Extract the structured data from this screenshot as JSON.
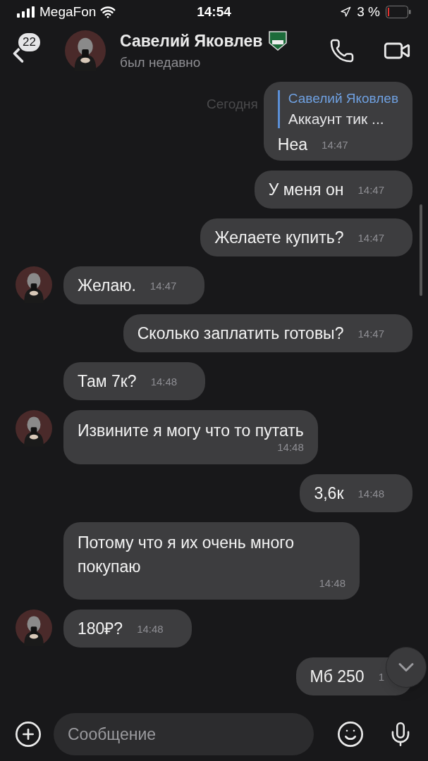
{
  "status_bar": {
    "carrier": "MegaFon",
    "time": "14:54",
    "battery": "3 %"
  },
  "header": {
    "back_badge": "22",
    "name": "Савелий Яковлев",
    "status": "был недавно"
  },
  "date_label": "Сегодня",
  "messages": [
    {
      "kind": "out",
      "reply": {
        "author": "Савелий Яковлев",
        "text": "Аккаунт тик ..."
      },
      "text": "Неа",
      "time": "14:47"
    },
    {
      "kind": "out",
      "text": "У меня он",
      "time": "14:47"
    },
    {
      "kind": "out",
      "text": "Желаете купить?",
      "time": "14:47"
    },
    {
      "kind": "in",
      "avatar": true,
      "text": "Желаю.",
      "time": "14:47"
    },
    {
      "kind": "out",
      "text": "Сколько заплатить готовы?",
      "time": "14:47"
    },
    {
      "kind": "in",
      "avatar": false,
      "text": "Там 7к?",
      "time": "14:48"
    },
    {
      "kind": "in",
      "avatar": true,
      "text": "Извините я могу что то путать",
      "time": "14:48",
      "wrap": true
    },
    {
      "kind": "out",
      "text": "3,6к",
      "time": "14:48"
    },
    {
      "kind": "in",
      "avatar": false,
      "text": "Потому что я их очень много покупаю",
      "time": "14:48",
      "wrap": true
    },
    {
      "kind": "in",
      "avatar": true,
      "text": "180₽?",
      "time": "14:48"
    },
    {
      "kind": "out",
      "text": "Мб 250",
      "time": "1"
    }
  ],
  "composer": {
    "placeholder": "Сообщение"
  }
}
